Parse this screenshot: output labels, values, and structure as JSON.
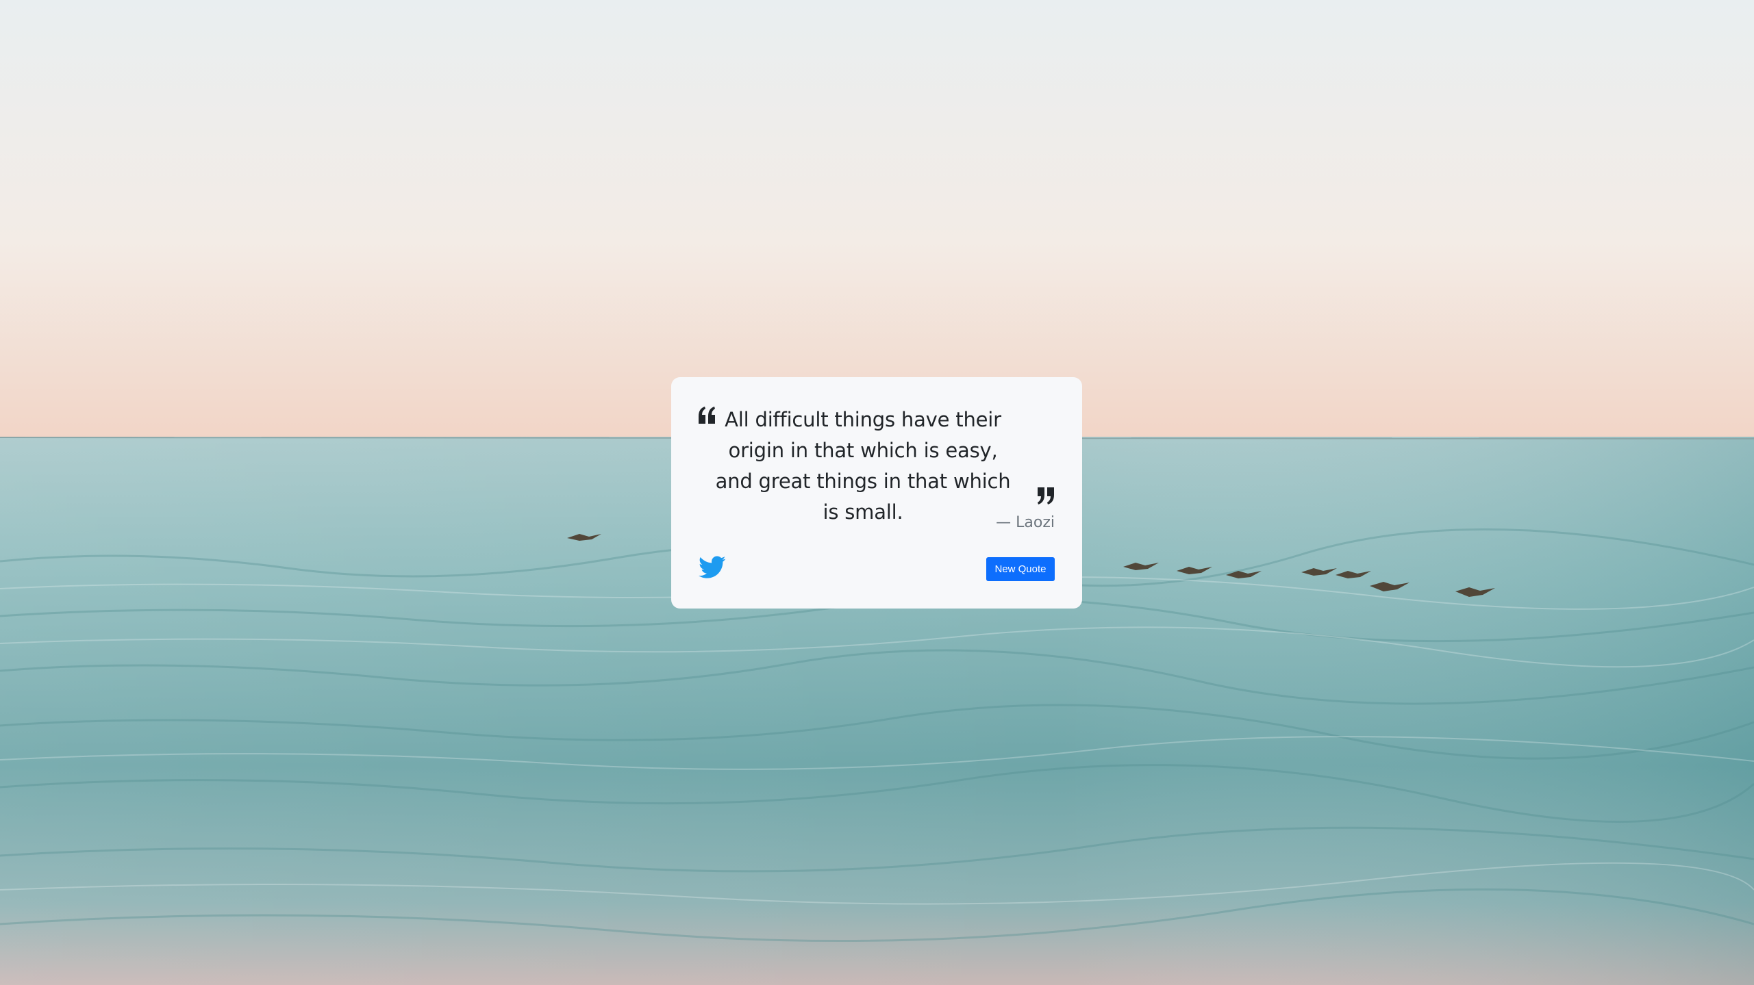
{
  "background": {
    "description_icon": "ocean-with-pelicans-photo",
    "sky_top_color": "#e9eef0",
    "sky_horizon_color": "#f2d7c9",
    "sea_color": "#8fbcbe",
    "sea_deep_color": "#5e9a9e"
  },
  "quote": {
    "text": "All difficult things have their origin in that which is easy, and great things in that which is small.",
    "author": "— Laozi",
    "open_icon": "quote-left-icon",
    "close_icon": "quote-right-icon"
  },
  "actions": {
    "tweet_icon": "twitter-icon",
    "tweet_color": "#1d9bf0",
    "new_quote_label": "New Quote",
    "new_quote_color": "#0d6efd"
  }
}
